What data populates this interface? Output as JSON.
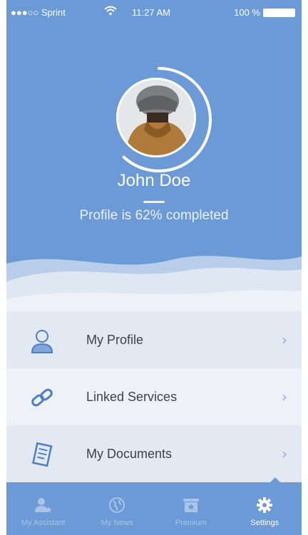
{
  "status_bar": {
    "carrier": "●●●○○ Sprint",
    "time": "11:27 AM",
    "battery": "100 %"
  },
  "profile": {
    "name": "John Doe",
    "completion_text": "Profile is 62% completed",
    "completion_fraction": 0.62
  },
  "menu": {
    "items": [
      {
        "label": "My Profile",
        "icon": "user-icon"
      },
      {
        "label": "Linked Services",
        "icon": "link-icon"
      },
      {
        "label": "My Documents",
        "icon": "document-icon"
      }
    ]
  },
  "tabbar": {
    "tabs": [
      {
        "label": "My Assistant",
        "icon": "assistant-icon",
        "active": false
      },
      {
        "label": "My News",
        "icon": "globe-icon",
        "active": false
      },
      {
        "label": "Premium",
        "icon": "premium-icon",
        "active": false
      },
      {
        "label": "Settings",
        "icon": "gear-icon",
        "active": true
      }
    ]
  },
  "colors": {
    "primary": "#6b9ad6",
    "accent": "#8fb0da",
    "text": "#3b4250"
  }
}
